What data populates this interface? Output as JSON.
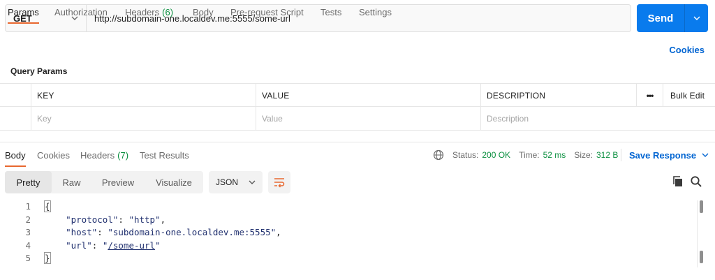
{
  "request": {
    "method": "GET",
    "url": "http://subdomain-one.localdev.me:5555/some-url",
    "send_label": "Send"
  },
  "request_tabs": [
    {
      "label": "Params",
      "active": true
    },
    {
      "label": "Authorization"
    },
    {
      "label": "Headers",
      "count": "(6)"
    },
    {
      "label": "Body"
    },
    {
      "label": "Pre-request Script"
    },
    {
      "label": "Tests"
    },
    {
      "label": "Settings"
    }
  ],
  "cookies_link": "Cookies",
  "query_params": {
    "title": "Query Params",
    "headers": {
      "key": "KEY",
      "value": "VALUE",
      "description": "DESCRIPTION",
      "more": "•••",
      "bulk_edit": "Bulk Edit"
    },
    "placeholders": {
      "key": "Key",
      "value": "Value",
      "description": "Description"
    }
  },
  "response_tabs": [
    {
      "label": "Body",
      "active": true
    },
    {
      "label": "Cookies"
    },
    {
      "label": "Headers",
      "count": "(7)"
    },
    {
      "label": "Test Results"
    }
  ],
  "status": {
    "status_label": "Status:",
    "status_value": "200 OK",
    "time_label": "Time:",
    "time_value": "52 ms",
    "size_label": "Size:",
    "size_value": "312 B"
  },
  "save_response": "Save Response",
  "view_modes": [
    {
      "label": "Pretty",
      "active": true
    },
    {
      "label": "Raw"
    },
    {
      "label": "Preview"
    },
    {
      "label": "Visualize"
    }
  ],
  "format": "JSON",
  "code_lines": [
    {
      "num": "1",
      "text": "{"
    },
    {
      "num": "2",
      "key": "\"protocol\"",
      "value": "\"http\"",
      "trail": ","
    },
    {
      "num": "3",
      "key": "\"host\"",
      "value": "\"subdomain-one.localdev.me:5555\"",
      "trail": ","
    },
    {
      "num": "4",
      "key": "\"url\"",
      "value_open": "\"",
      "value_link": "/some-url",
      "value_close": "\""
    },
    {
      "num": "5",
      "text": "}"
    }
  ],
  "colors": {
    "accent": "#097bed",
    "tab_underline": "#e8672f",
    "status_ok": "#0a8f3f",
    "link": "#0265d2"
  }
}
